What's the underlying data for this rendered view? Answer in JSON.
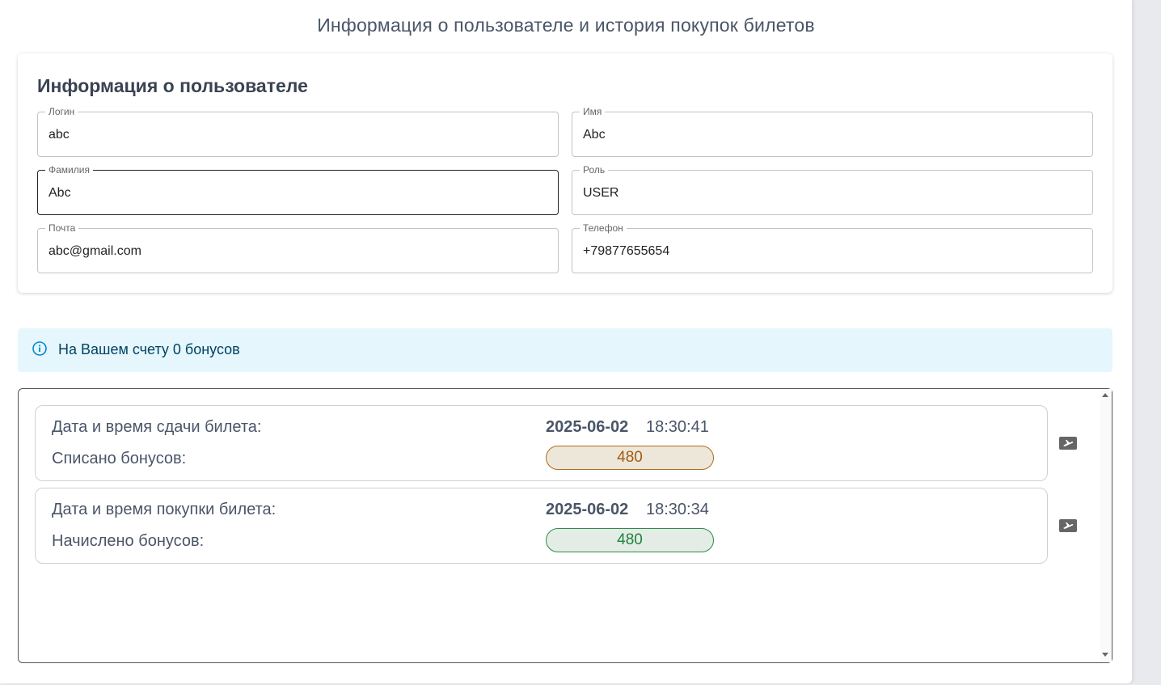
{
  "page": {
    "title": "Информация о пользователе и история покупок билетов"
  },
  "user_info": {
    "title": "Информация о пользователе",
    "fields": {
      "login": {
        "label": "Логин",
        "value": "abc"
      },
      "first_name": {
        "label": "Имя",
        "value": "Abc"
      },
      "last_name": {
        "label": "Фамилия",
        "value": "Abc"
      },
      "role": {
        "label": "Роль",
        "value": "USER"
      },
      "email": {
        "label": "Почта",
        "value": "abc@gmail.com"
      },
      "phone": {
        "label": "Телефон",
        "value": "+79877655654"
      }
    }
  },
  "bonus_alert": {
    "icon": "info-icon",
    "text": "На Вашем счету 0 бонусов"
  },
  "history": {
    "entries": [
      {
        "datetime_label": "Дата и время сдачи билета:",
        "date": "2025-06-02",
        "time": "18:30:41",
        "bonus_label": "Списано бонусов:",
        "bonus_value": "480",
        "kind": "spent",
        "icon": "ticket-icon"
      },
      {
        "datetime_label": "Дата и время покупки билета:",
        "date": "2025-06-02",
        "time": "18:30:34",
        "bonus_label": "Начислено бонусов:",
        "bonus_value": "480",
        "kind": "earned",
        "icon": "ticket-icon"
      }
    ]
  },
  "colors": {
    "spent_text": "#a25c12",
    "spent_bg": "#ede7da",
    "earned_text": "#23803e",
    "earned_bg": "#e3ede6",
    "alert_bg": "#e5f6fd",
    "alert_icon": "#0288d1"
  }
}
